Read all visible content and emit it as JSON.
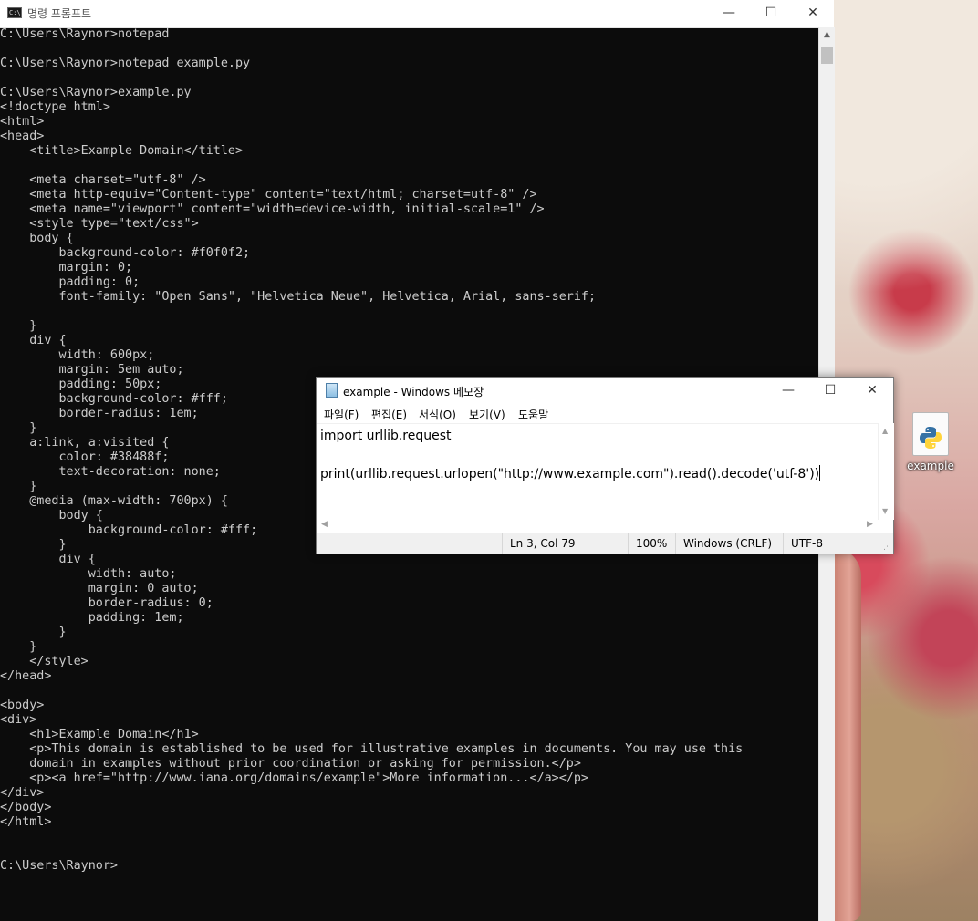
{
  "cmd": {
    "title": "명령 프롬프트",
    "icon_text": "C:\\",
    "controls": {
      "minimize": "—",
      "maximize": "☐",
      "close": "✕"
    },
    "lines": [
      "C:\\Users\\Raynor>notepad",
      "",
      "C:\\Users\\Raynor>notepad example.py",
      "",
      "C:\\Users\\Raynor>example.py",
      "<!doctype html>",
      "<html>",
      "<head>",
      "    <title>Example Domain</title>",
      "",
      "    <meta charset=\"utf-8\" />",
      "    <meta http-equiv=\"Content-type\" content=\"text/html; charset=utf-8\" />",
      "    <meta name=\"viewport\" content=\"width=device-width, initial-scale=1\" />",
      "    <style type=\"text/css\">",
      "    body {",
      "        background-color: #f0f0f2;",
      "        margin: 0;",
      "        padding: 0;",
      "        font-family: \"Open Sans\", \"Helvetica Neue\", Helvetica, Arial, sans-serif;",
      "",
      "    }",
      "    div {",
      "        width: 600px;",
      "        margin: 5em auto;",
      "        padding: 50px;",
      "        background-color: #fff;",
      "        border-radius: 1em;",
      "    }",
      "    a:link, a:visited {",
      "        color: #38488f;",
      "        text-decoration: none;",
      "    }",
      "    @media (max-width: 700px) {",
      "        body {",
      "            background-color: #fff;",
      "        }",
      "        div {",
      "            width: auto;",
      "            margin: 0 auto;",
      "            border-radius: 0;",
      "            padding: 1em;",
      "        }",
      "    }",
      "    </style>",
      "</head>",
      "",
      "<body>",
      "<div>",
      "    <h1>Example Domain</h1>",
      "    <p>This domain is established to be used for illustrative examples in documents. You may use this",
      "    domain in examples without prior coordination or asking for permission.</p>",
      "    <p><a href=\"http://www.iana.org/domains/example\">More information...</a></p>",
      "</div>",
      "</body>",
      "</html>",
      "",
      "",
      "C:\\Users\\Raynor>"
    ]
  },
  "notepad": {
    "title": "example - Windows 메모장",
    "controls": {
      "minimize": "—",
      "maximize": "☐",
      "close": "✕"
    },
    "menu": [
      "파일(F)",
      "편집(E)",
      "서식(O)",
      "보기(V)",
      "도움말"
    ],
    "content_lines": [
      "import urllib.request",
      "",
      "print(urllib.request.urlopen(\"http://www.example.com\").read().decode('utf-8'))"
    ],
    "status": {
      "position": "Ln 3, Col 79",
      "zoom": "100%",
      "line_ending": "Windows (CRLF)",
      "encoding": "UTF-8"
    }
  },
  "desktop": {
    "icon_label": "example",
    "icon_name": "python-file-icon"
  },
  "colors": {
    "console_bg": "#0c0c0c",
    "console_text": "#cccccc",
    "python_blue": "#3572a5",
    "python_yellow": "#ffd43b"
  }
}
